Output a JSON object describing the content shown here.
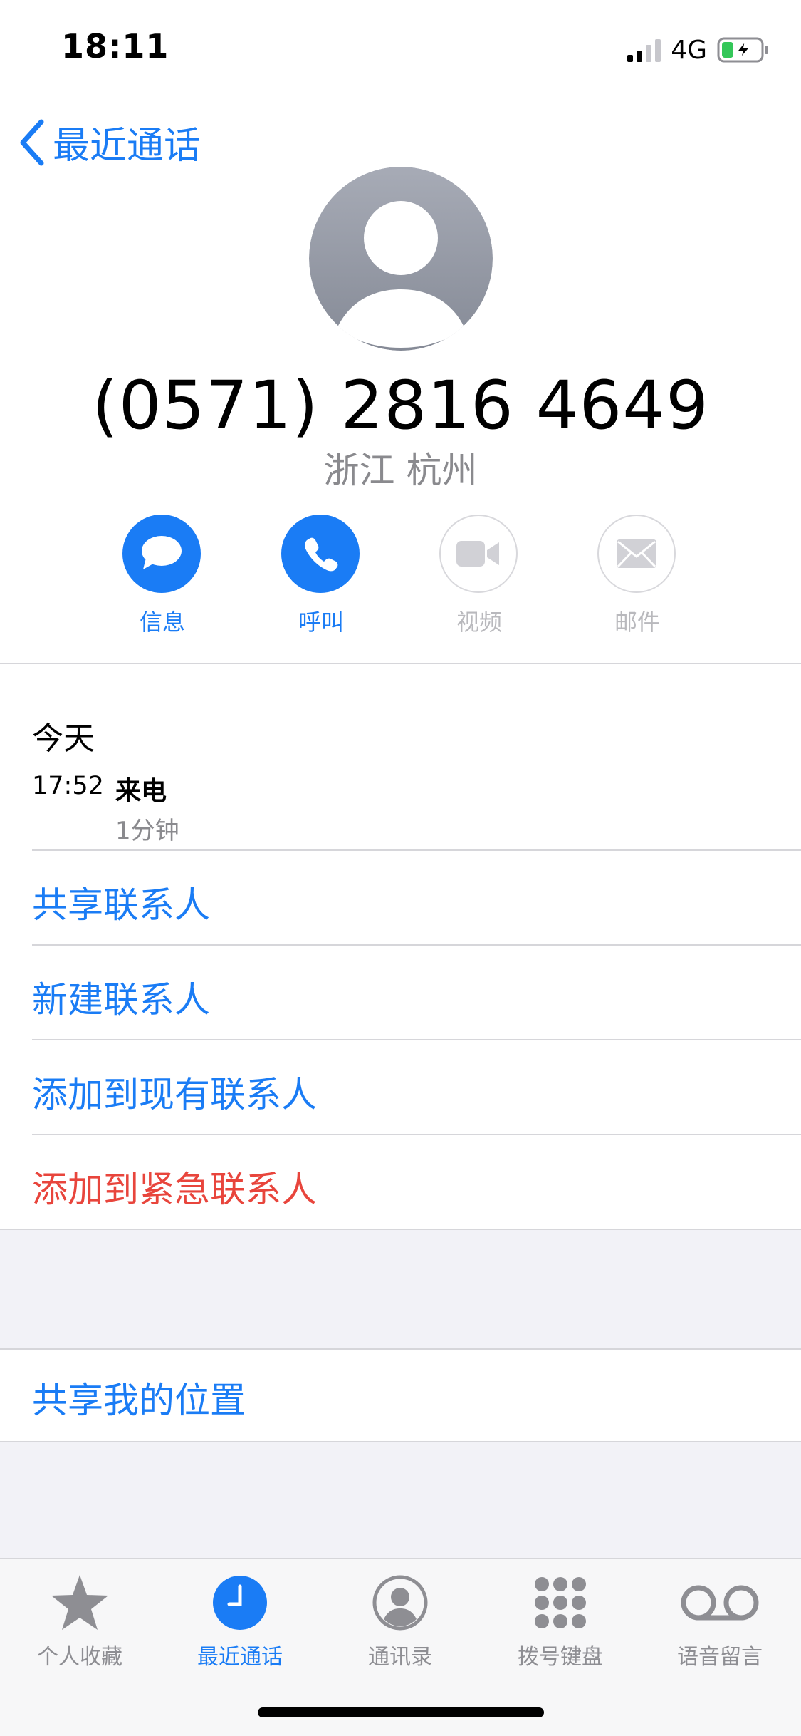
{
  "status_bar": {
    "time": "18:11",
    "network": "4G"
  },
  "nav": {
    "back_label": "最近通话"
  },
  "contact": {
    "phone_number": "(0571) 2816 4649",
    "location": "浙江 杭州"
  },
  "actions": [
    {
      "label": "信息",
      "icon": "message-icon",
      "enabled": true
    },
    {
      "label": "呼叫",
      "icon": "phone-icon",
      "enabled": true
    },
    {
      "label": "视频",
      "icon": "video-icon",
      "enabled": false
    },
    {
      "label": "邮件",
      "icon": "mail-icon",
      "enabled": false
    }
  ],
  "history": {
    "day_label": "今天",
    "entries": [
      {
        "time": "17:52",
        "type": "来电",
        "duration": "1分钟"
      }
    ]
  },
  "menu": {
    "share_contact": "共享联系人",
    "new_contact": "新建联系人",
    "add_existing": "添加到现有联系人",
    "add_emergency": "添加到紧急联系人",
    "share_location": "共享我的位置"
  },
  "tab_bar": {
    "tabs": [
      {
        "label": "个人收藏",
        "icon": "star-icon",
        "active": false
      },
      {
        "label": "最近通话",
        "icon": "clock-icon",
        "active": true
      },
      {
        "label": "通讯录",
        "icon": "contacts-icon",
        "active": false
      },
      {
        "label": "拨号键盘",
        "icon": "keypad-icon",
        "active": false
      },
      {
        "label": "语音留言",
        "icon": "voicemail-icon",
        "active": false
      }
    ]
  },
  "colors": {
    "accent": "#1a7cf5",
    "destructive": "#e8453c",
    "secondary_text": "#8a8a8e"
  }
}
